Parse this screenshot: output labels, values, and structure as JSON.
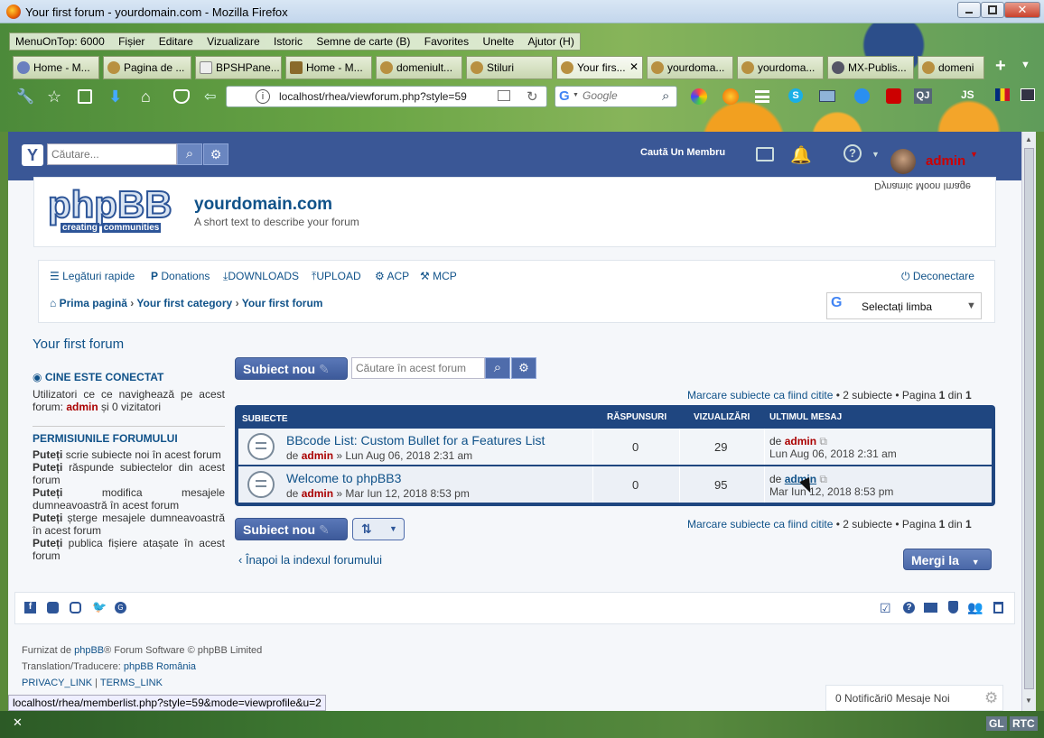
{
  "window": {
    "title": "Your first forum - yourdomain.com - Mozilla Firefox"
  },
  "menubar": {
    "items": [
      "MenuOnTop: 6000",
      "Fișier",
      "Editare",
      "Vizualizare",
      "Istoric",
      "Semne de carte (B)",
      "Favorites",
      "Unelte",
      "Ajutor (H)"
    ]
  },
  "tabs": [
    {
      "label": "Home - M..."
    },
    {
      "label": "Pagina de ..."
    },
    {
      "label": "BPSHPane..."
    },
    {
      "label": "Home - M..."
    },
    {
      "label": "domeniult..."
    },
    {
      "label": "Stiluri"
    },
    {
      "label": "Your firs..."
    },
    {
      "label": "yourdoma..."
    },
    {
      "label": "yourdoma..."
    },
    {
      "label": "MX-Publis..."
    },
    {
      "label": "domeni"
    }
  ],
  "address": {
    "url": "localhost/rhea/viewforum.php?style=59",
    "search_placeholder": "Google"
  },
  "topnav": {
    "search_placeholder": "Căutare...",
    "find_member": "Caută Un Membru",
    "username": "admin"
  },
  "header": {
    "site_name": "yourdomain.com",
    "site_desc": "A short text to describe your forum",
    "moon_label": "Dynamic Moon Image",
    "logo_text": "phpBB",
    "logo_sub1": "creating",
    "logo_sub2": "communities"
  },
  "quicklinks": {
    "quick": "Legături rapide",
    "donations": "Donations",
    "downloads": "DOWNLOADS",
    "upload": "UPLOAD",
    "acp": "ACP",
    "mcp": "MCP",
    "logout": "Deconectare"
  },
  "breadcrumb": [
    "Prima pagină",
    "Your first category",
    "Your first forum"
  ],
  "language": {
    "selected": "Selectați limba"
  },
  "forum_title": "Your first forum",
  "sidebar": {
    "who_online_title": "CINE ESTE CONECTAT",
    "who_online_text1": "Utilizatori ce ce navighează pe acest forum:",
    "who_online_user": "admin",
    "who_online_text2": "și 0 vizitatori",
    "perms_title": "PERMISIUNILE FORUMULUI",
    "perms": [
      {
        "b": "Puteți",
        "t": "scrie subiecte noi în acest forum"
      },
      {
        "b": "Puteți",
        "t": "răspunde subiectelor din acest forum"
      },
      {
        "b": "Puteți",
        "t": "modifica mesajele dumneavoastră în acest forum"
      },
      {
        "b": "Puteți",
        "t": "șterge mesajele dumneavoastră în acest forum"
      },
      {
        "b": "Puteți",
        "t": "publica fișiere atașate în acest forum"
      }
    ]
  },
  "actions": {
    "new_topic": "Subiect nou",
    "search_forum_placeholder": "Căutare în acest forum",
    "mark_read": "Marcare subiecte ca fiind citite",
    "topic_count": "2 subiecte",
    "page_label": "Pagina",
    "page_current": "1",
    "page_of": "din",
    "page_total": "1",
    "sep1": "•",
    "sep2": "•",
    "back_index": "Înapoi la indexul forumului",
    "jump": "Mergi la"
  },
  "table": {
    "headers": [
      "SUBIECTE",
      "RĂSPUNSURI",
      "VIZUALIZĂRI",
      "ULTIMUL MESAJ"
    ],
    "rows": [
      {
        "title": "BBcode List: Custom Bullet for a Features List",
        "by": "de",
        "author": "admin",
        "date": "» Lun Aug 06, 2018 2:31 am",
        "replies": "0",
        "views": "29",
        "last_by": "de",
        "last_author": "admin",
        "last_date": "Lun Aug 06, 2018 2:31 am"
      },
      {
        "title": "Welcome to phpBB3",
        "by": "de",
        "author": "admin",
        "date": "» Mar Iun 12, 2018 8:53 pm",
        "replies": "0",
        "views": "95",
        "last_by": "de",
        "last_author": "admin",
        "last_date": "Mar Iun 12, 2018 8:53 pm"
      }
    ]
  },
  "footer": {
    "powered1": "Furnizat de",
    "powered_link": "phpBB",
    "powered2": "® Forum Software © phpBB Limited",
    "translation": "Translation/Traducere:",
    "translation_link": "phpBB România",
    "privacy": "PRIVACY_LINK",
    "terms": "TERMS_LINK",
    "sep": "|",
    "notifications": "0 Notificări0 Mesaje Noi"
  },
  "statusbar": {
    "url": "localhost/rhea/memberlist.php?style=59&mode=viewprofile&u=2"
  },
  "taskbar": {
    "gl": "GL",
    "rtc": "RTC"
  },
  "colors": {
    "navbar": "#3a5796",
    "link": "#105289",
    "username": "#aa0000",
    "forum_head": "#1f4680"
  }
}
